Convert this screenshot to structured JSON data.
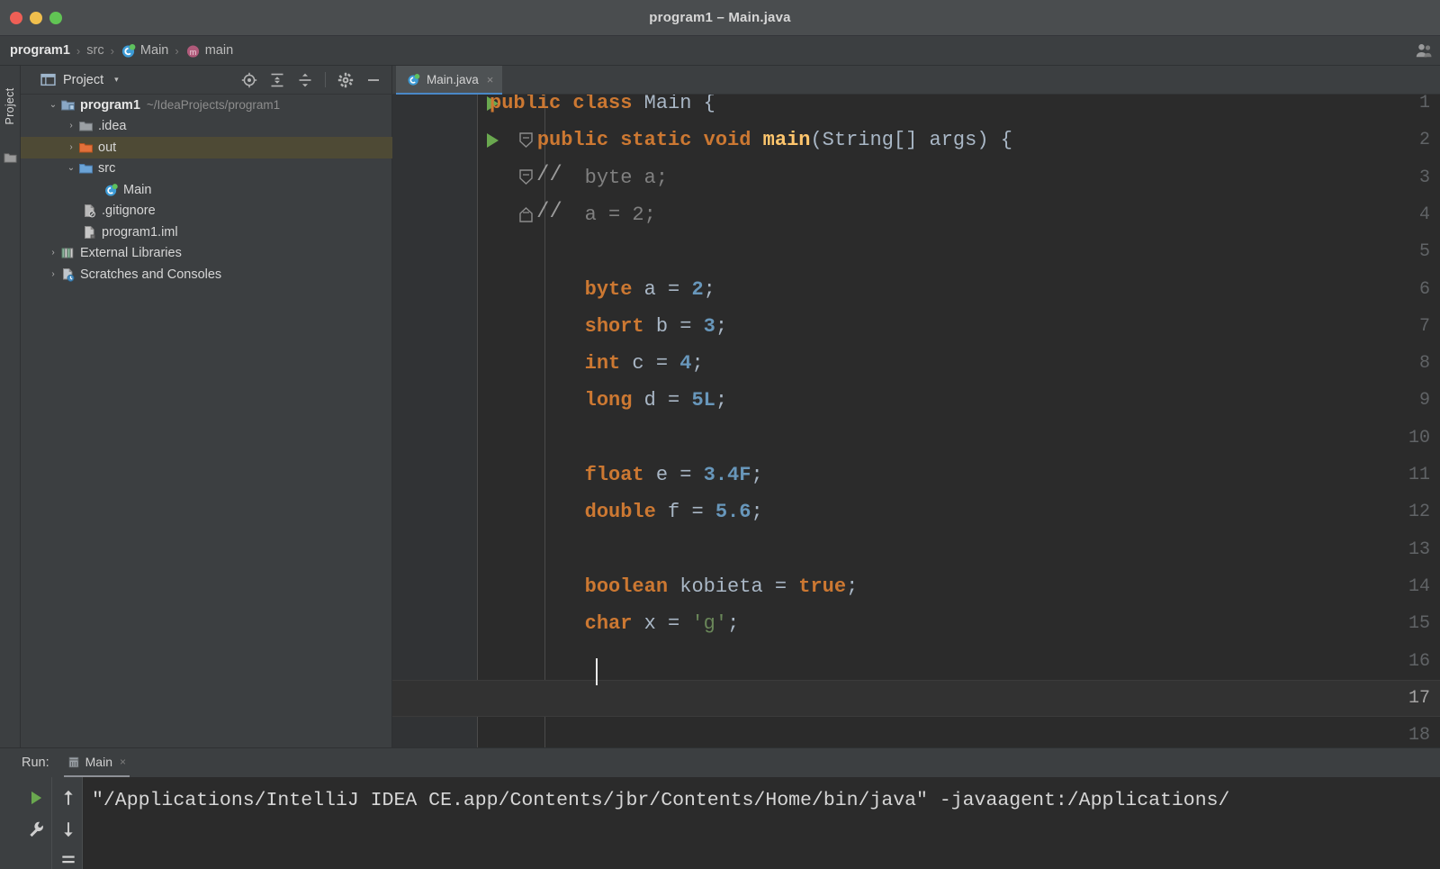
{
  "window": {
    "title": "program1 – Main.java",
    "controls": [
      "close",
      "minimize",
      "zoom"
    ]
  },
  "breadcrumb": {
    "items": [
      {
        "label": "program1",
        "icon": "none",
        "bold": true
      },
      {
        "label": "src",
        "icon": "none",
        "bold": false
      },
      {
        "label": "Main",
        "icon": "class-icon",
        "bold": false
      },
      {
        "label": "main",
        "icon": "method-icon",
        "bold": false
      }
    ],
    "separator": "›",
    "account_icon": "account-icon"
  },
  "left_strip": {
    "label": "Project",
    "icon": "folder-icon"
  },
  "project_panel": {
    "title": "Project",
    "title_icon": "project-window-icon",
    "caret": "▾",
    "tools": [
      {
        "name": "locate-in-tree-icon",
        "label": "Select Opened File"
      },
      {
        "name": "expand-all-icon",
        "label": "Expand All"
      },
      {
        "name": "collapse-all-icon",
        "label": "Collapse All"
      },
      {
        "name": "settings-gear-icon",
        "label": "Options"
      },
      {
        "name": "hide-panel-icon",
        "label": "Hide"
      }
    ],
    "tree": [
      {
        "label": "program1",
        "path": "~/IdeaProjects/program1",
        "icon": "project-root-icon",
        "twist": "⌄",
        "indent": 0,
        "bold": true,
        "selected": false
      },
      {
        "label": ".idea",
        "path": "",
        "icon": "folder-icon",
        "twist": "›",
        "indent": 1,
        "bold": false,
        "selected": false
      },
      {
        "label": "out",
        "path": "",
        "icon": "folder-orange-icon",
        "twist": "›",
        "indent": 1,
        "bold": false,
        "selected": true
      },
      {
        "label": "src",
        "path": "",
        "icon": "folder-blue-icon",
        "twist": "⌄",
        "indent": 1,
        "bold": false,
        "selected": false
      },
      {
        "label": "Main",
        "path": "",
        "icon": "class-icon",
        "twist": "",
        "indent": 2,
        "bold": false,
        "selected": false
      },
      {
        "label": ".gitignore",
        "path": "",
        "icon": "gitignore-icon",
        "twist": "",
        "indent": 1,
        "bold": false,
        "selected": false
      },
      {
        "label": "program1.iml",
        "path": "",
        "icon": "iml-icon",
        "twist": "",
        "indent": 1,
        "bold": false,
        "selected": false
      },
      {
        "label": "External Libraries",
        "path": "",
        "icon": "libraries-icon",
        "twist": "›",
        "indent": 0,
        "bold": false,
        "selected": false
      },
      {
        "label": "Scratches and Consoles",
        "path": "",
        "icon": "scratches-icon",
        "twist": "›",
        "indent": 0,
        "bold": false,
        "selected": false
      }
    ]
  },
  "editor": {
    "tab": {
      "label": "Main.java",
      "icon": "java-class-icon",
      "close": "×",
      "active": true
    },
    "caret_line": 17,
    "caret_column": 9,
    "lines": [
      {
        "n": 1,
        "indent": 0,
        "runmark": true,
        "fold": "",
        "tokens": [
          {
            "t": "public",
            "c": "kw"
          },
          {
            "t": " ",
            "c": "pl"
          },
          {
            "t": "class",
            "c": "kw"
          },
          {
            "t": " Main {",
            "c": "pl"
          }
        ]
      },
      {
        "n": 2,
        "indent": 0,
        "runmark": true,
        "fold": "open",
        "tokens": [
          {
            "t": "    ",
            "c": "pl"
          },
          {
            "t": "public",
            "c": "kw"
          },
          {
            "t": " ",
            "c": "pl"
          },
          {
            "t": "static",
            "c": "kw"
          },
          {
            "t": " ",
            "c": "pl"
          },
          {
            "t": "void",
            "c": "kw"
          },
          {
            "t": " ",
            "c": "pl"
          },
          {
            "t": "main",
            "c": "mth"
          },
          {
            "t": "(String[] args) {",
            "c": "pl"
          }
        ]
      },
      {
        "n": 3,
        "indent": 0,
        "runmark": false,
        "fold": "cmt1",
        "tokens": [
          {
            "t": "        byte ",
            "c": "cmt"
          },
          {
            "t": "a",
            "c": "cmt err"
          },
          {
            "t": ";",
            "c": "cmt"
          }
        ]
      },
      {
        "n": 4,
        "indent": 0,
        "runmark": false,
        "fold": "cmt2",
        "tokens": [
          {
            "t": "        a = 2;",
            "c": "cmt"
          }
        ]
      },
      {
        "n": 5,
        "indent": 0,
        "runmark": false,
        "fold": "",
        "tokens": []
      },
      {
        "n": 6,
        "indent": 0,
        "runmark": false,
        "fold": "",
        "tokens": [
          {
            "t": "        ",
            "c": "pl"
          },
          {
            "t": "byte",
            "c": "kw"
          },
          {
            "t": " a = ",
            "c": "pl"
          },
          {
            "t": "2",
            "c": "num"
          },
          {
            "t": ";",
            "c": "pl"
          }
        ]
      },
      {
        "n": 7,
        "indent": 0,
        "runmark": false,
        "fold": "",
        "tokens": [
          {
            "t": "        ",
            "c": "pl"
          },
          {
            "t": "short",
            "c": "kw"
          },
          {
            "t": " b = ",
            "c": "pl"
          },
          {
            "t": "3",
            "c": "num"
          },
          {
            "t": ";",
            "c": "pl"
          }
        ]
      },
      {
        "n": 8,
        "indent": 0,
        "runmark": false,
        "fold": "",
        "tokens": [
          {
            "t": "        ",
            "c": "pl"
          },
          {
            "t": "int",
            "c": "kw"
          },
          {
            "t": " c = ",
            "c": "pl"
          },
          {
            "t": "4",
            "c": "num"
          },
          {
            "t": ";",
            "c": "pl"
          }
        ]
      },
      {
        "n": 9,
        "indent": 0,
        "runmark": false,
        "fold": "",
        "tokens": [
          {
            "t": "        ",
            "c": "pl"
          },
          {
            "t": "long",
            "c": "kw"
          },
          {
            "t": " d = ",
            "c": "pl"
          },
          {
            "t": "5L",
            "c": "num"
          },
          {
            "t": ";",
            "c": "pl"
          }
        ]
      },
      {
        "n": 10,
        "indent": 0,
        "runmark": false,
        "fold": "",
        "tokens": []
      },
      {
        "n": 11,
        "indent": 0,
        "runmark": false,
        "fold": "",
        "tokens": [
          {
            "t": "        ",
            "c": "pl"
          },
          {
            "t": "float",
            "c": "kw"
          },
          {
            "t": " e = ",
            "c": "pl"
          },
          {
            "t": "3.4F",
            "c": "num"
          },
          {
            "t": ";",
            "c": "pl"
          }
        ]
      },
      {
        "n": 12,
        "indent": 0,
        "runmark": false,
        "fold": "",
        "tokens": [
          {
            "t": "        ",
            "c": "pl"
          },
          {
            "t": "double",
            "c": "kw"
          },
          {
            "t": " f = ",
            "c": "pl"
          },
          {
            "t": "5.6",
            "c": "num"
          },
          {
            "t": ";",
            "c": "pl"
          }
        ]
      },
      {
        "n": 13,
        "indent": 0,
        "runmark": false,
        "fold": "",
        "tokens": []
      },
      {
        "n": 14,
        "indent": 0,
        "runmark": false,
        "fold": "",
        "tokens": [
          {
            "t": "        ",
            "c": "pl"
          },
          {
            "t": "boolean",
            "c": "kw"
          },
          {
            "t": " ",
            "c": "pl"
          },
          {
            "t": "kobieta",
            "c": "pl warn-sq"
          },
          {
            "t": " = ",
            "c": "pl"
          },
          {
            "t": "true",
            "c": "kw"
          },
          {
            "t": ";",
            "c": "pl"
          }
        ]
      },
      {
        "n": 15,
        "indent": 0,
        "runmark": false,
        "fold": "",
        "tokens": [
          {
            "t": "        ",
            "c": "pl"
          },
          {
            "t": "char",
            "c": "kw"
          },
          {
            "t": " x = ",
            "c": "pl"
          },
          {
            "t": "'g'",
            "c": "str"
          },
          {
            "t": ";",
            "c": "pl"
          }
        ]
      },
      {
        "n": 16,
        "indent": 0,
        "runmark": false,
        "fold": "",
        "tokens": []
      },
      {
        "n": 17,
        "indent": 0,
        "runmark": false,
        "fold": "",
        "tokens": []
      },
      {
        "n": 18,
        "indent": 0,
        "runmark": false,
        "fold": "",
        "tokens": []
      }
    ]
  },
  "run_panel": {
    "label": "Run:",
    "tab": {
      "label": "Main",
      "icon": "run-config-icon",
      "close": "×"
    },
    "tools": [
      {
        "name": "rerun-icon",
        "label": "Rerun"
      },
      {
        "name": "wrench-icon",
        "label": "Edit Configuration"
      },
      {
        "name": "scroll-up-icon",
        "label": "Up"
      },
      {
        "name": "scroll-down-icon",
        "label": "Down"
      },
      {
        "name": "soft-wrap-icon",
        "label": "Soft-Wrap"
      }
    ],
    "console_output": "\"/Applications/IntelliJ IDEA CE.app/Contents/jbr/Contents/Home/bin/java\" -javaagent:/Applications/"
  },
  "colors": {
    "bg_chrome": "#3c3f41",
    "bg_editor": "#2b2b2b",
    "gutter": "#313335",
    "accent_tab": "#4a88c7",
    "keyword": "#cc7832",
    "number": "#6897bb",
    "string": "#6a8759",
    "method": "#ffc66d",
    "comment": "#808080",
    "plain": "#a9b7c6",
    "selection": "#4e4a35",
    "error": "#c75450",
    "run_green": "#6aa84f"
  }
}
